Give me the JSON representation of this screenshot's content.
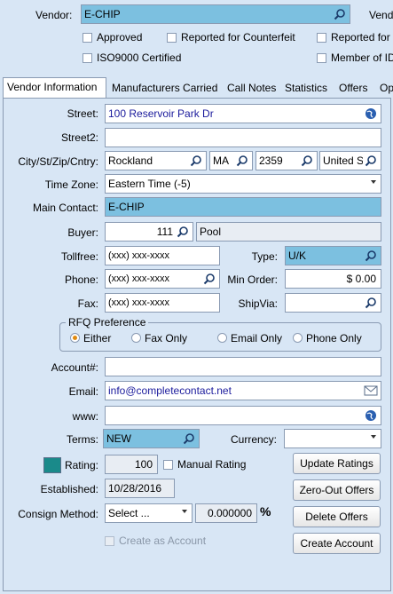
{
  "vendor": {
    "label": "Vendor:",
    "value": "E-CHIP",
    "label_right": "Vend"
  },
  "flags": [
    {
      "label": "Approved"
    },
    {
      "label": "Reported for Counterfeit"
    },
    {
      "label": "Reported for M"
    },
    {
      "label": "ISO9000 Certified"
    },
    {
      "label": "Member of ID"
    }
  ],
  "tabs": [
    "Vendor Information",
    "Manufacturers Carried",
    "Call Notes",
    "Statistics",
    "Offers",
    "Op"
  ],
  "form": {
    "street_label": "Street:",
    "street": "100 Reservoir Park Dr",
    "street2_label": "Street2:",
    "street2": "",
    "city_label": "City/St/Zip/Cntry:",
    "city": "Rockland",
    "state": "MA",
    "zip": "2359",
    "country": "United S",
    "timezone_label": "Time Zone:",
    "timezone": "Eastern Time (-5)",
    "contact_label": "Main Contact:",
    "contact": "E-CHIP",
    "buyer_label": "Buyer:",
    "buyer_id": "111",
    "buyer_name": "Pool",
    "tollfree_label": "Tollfree:",
    "tollfree": "(xxx) xxx-xxxx",
    "type_label": "Type:",
    "type": "U/K",
    "phone_label": "Phone:",
    "phone": "(xxx) xxx-xxxx",
    "minorder_label": "Min Order:",
    "minorder": "$ 0.00",
    "fax_label": "Fax:",
    "fax": "(xxx) xxx-xxxx",
    "shipvia_label": "ShipVia:",
    "shipvia": "",
    "rfq_title": "RFQ Preference",
    "rfq_options": [
      "Either",
      "Fax Only",
      "Email Only",
      "Phone Only"
    ],
    "account_label": "Account#:",
    "account": "",
    "email_label": "Email:",
    "email": "info@completecontact.net",
    "www_label": "www:",
    "www": "",
    "terms_label": "Terms:",
    "terms": "NEW",
    "currency_label": "Currency:",
    "currency": "",
    "rating_label": "Rating:",
    "rating": "100",
    "manual_rating_label": "Manual Rating",
    "established_label": "Established:",
    "established": "10/28/2016",
    "consign_label": "Consign Method:",
    "consign": "Select ...",
    "consign_pct": "0.000000",
    "pct_symbol": "%",
    "create_as_account_label": "Create as Account"
  },
  "buttons": {
    "update": "Update Ratings",
    "zero": "Zero-Out Offers",
    "delete": "Delete Offers",
    "create": "Create Account"
  },
  "colors": {
    "background": "#d8e6f5",
    "highlight": "#7cc0e0",
    "rating_swatch": "#1a8a8a",
    "link_text": "#1a1a9c"
  }
}
